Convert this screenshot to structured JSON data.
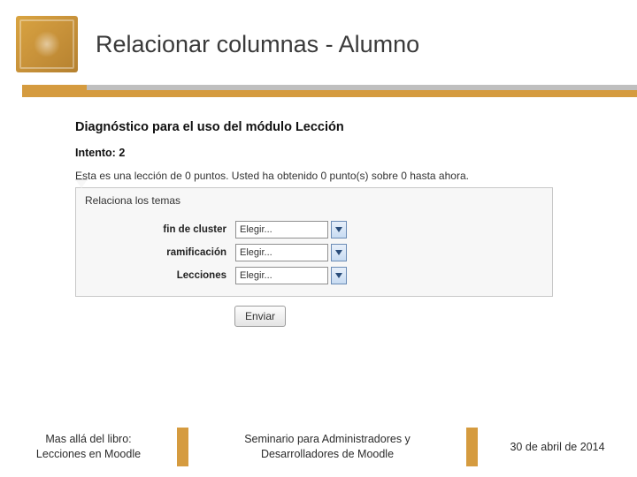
{
  "header": {
    "title": "Relacionar columnas - Alumno"
  },
  "diag": {
    "title": "Diagnóstico para el uso del módulo Lección",
    "intento_label": "Intento:",
    "intento_num": "2",
    "desc": "Esta es una lección de 0 puntos. Usted ha obtenido 0 punto(s) sobre 0 hasta ahora.",
    "panel_title": "Relaciona los temas",
    "rows": [
      {
        "label": "fin de cluster",
        "value": "Elegir..."
      },
      {
        "label": "ramificación",
        "value": "Elegir..."
      },
      {
        "label": "Lecciones",
        "value": "Elegir..."
      }
    ],
    "submit": "Enviar"
  },
  "footer": {
    "left_line1": "Mas allá del libro:",
    "left_line2": "Lecciones en Moodle",
    "mid_line1": "Seminario para Administradores y",
    "mid_line2": "Desarrolladores de Moodle",
    "right": "30 de abril de 2014"
  }
}
